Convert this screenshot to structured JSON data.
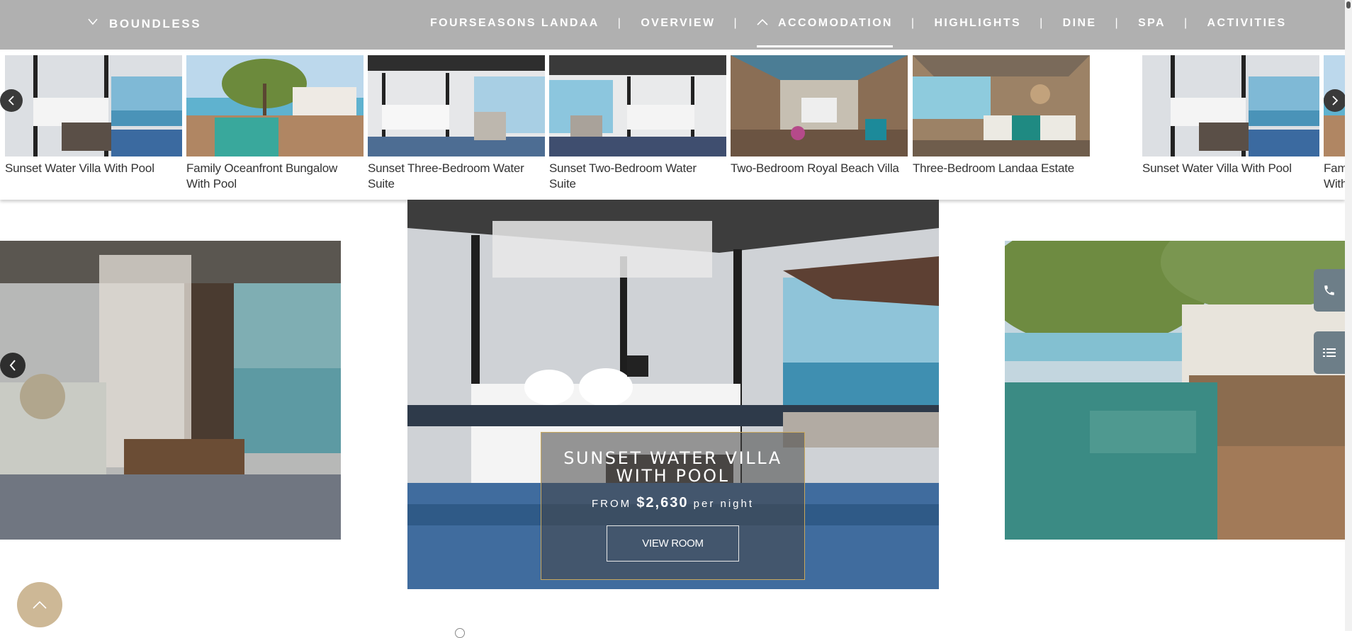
{
  "nav": {
    "brand": "BOUNDLESS",
    "brand_icon": "chevron-down-icon",
    "links": [
      "FOURSEASONS LANDAA",
      "OVERVIEW",
      "ACCOMODATION",
      "HIGHLIGHTS",
      "DINE",
      "SPA",
      "ACTIVITIES"
    ],
    "separator": "|",
    "active_link": "ACCOMODATION",
    "active_icon": "chevron-up-icon"
  },
  "strip": {
    "rooms": [
      "Sunset Water Villa With Pool",
      "Family Oceanfront Bungalow With Pool",
      "Sunset Three-Bedroom Water Suite",
      "Sunset Two-Bedroom Water Suite",
      "Two-Bedroom Royal Beach Villa",
      "Three-Bedroom Landaa Estate",
      "Sunset Water Villa With Pool",
      "Family Oceanfront Bungalow With Pool"
    ],
    "prev_icon": "chevron-left-icon",
    "next_icon": "chevron-right-icon"
  },
  "hero": {
    "title": "SUNSET WATER VILLA WITH POOL",
    "price_prefix": "FROM",
    "price": "$2,630",
    "price_suffix": "per night",
    "button": "VIEW ROOM",
    "prev_icon": "chevron-left-icon"
  },
  "side": {
    "phone_icon": "phone-icon",
    "menu_icon": "list-icon"
  },
  "to_top_icon": "chevron-up-icon",
  "colors": {
    "nav_bg": "#b0b0b0",
    "accent_gold": "#c9a85c",
    "side_button": "#6d7e88",
    "to_top": "#cdb896"
  }
}
